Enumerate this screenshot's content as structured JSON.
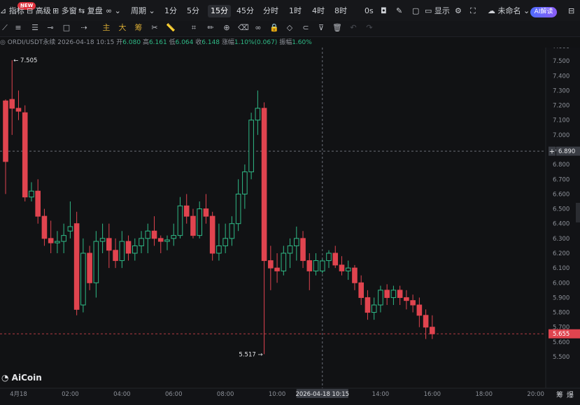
{
  "toolbar": {
    "new_badge": "NEW",
    "indicators": "指标",
    "advanced": "高级",
    "multi_window": "多窗",
    "replay": "复盘",
    "infinity": "∞",
    "period": "周期",
    "intervals": [
      "1分",
      "5分",
      "15分",
      "45分",
      "分时",
      "1时",
      "4时",
      "8时"
    ],
    "active_interval": "15分",
    "zero_s": "0s",
    "display": "显示",
    "unnamed": "未命名",
    "ai_explain": "AI解读"
  },
  "draw_tools": {
    "main": "主",
    "big": "大",
    "chips": "筹"
  },
  "info_bar": {
    "symbol": "ORDI/USDT永续",
    "datetime": "2026-04-18 10:15",
    "open_label": "开",
    "open": "6.080",
    "high_label": "高",
    "high": "6.161",
    "low_label": "低",
    "low": "6.064",
    "close_label": "收",
    "close": "6.148",
    "change_label": "涨幅",
    "change": "1.10%(0.067)",
    "amplitude_label": "振幅",
    "amplitude": "1.60%"
  },
  "watermark": "AiCoin",
  "price_axis": [
    "7.600",
    "7.500",
    "7.400",
    "7.300",
    "7.200",
    "7.100",
    "7.000",
    "6.900",
    "6.800",
    "6.700",
    "6.600",
    "6.500",
    "6.400",
    "6.300",
    "6.200",
    "6.100",
    "6.000",
    "5.900",
    "5.800",
    "5.700",
    "5.600",
    "5.500"
  ],
  "time_axis": [
    "4月18",
    "02:00",
    "04:00",
    "06:00",
    "08:00",
    "10:00",
    "12:00",
    "14:00",
    "16:00",
    "18:00",
    "20:00"
  ],
  "crosshair": {
    "price": "6.890",
    "time": "2026-04-18 10:15"
  },
  "last_price": "5.655",
  "high_marker": "← 7.505",
  "low_marker": "5.517 →",
  "bottom_right": [
    "筹",
    "爆"
  ],
  "colors": {
    "up": "#2fb986",
    "down": "#e0444f",
    "bg": "#111214",
    "crosshair": "#6b6f78"
  },
  "chart_data": {
    "type": "candlestick",
    "ylim": [
      5.45,
      7.65
    ],
    "x_ticks": [
      "4月18",
      "02:00",
      "04:00",
      "06:00",
      "08:00",
      "10:00",
      "12:00",
      "14:00",
      "16:00",
      "18:00",
      "20:00"
    ],
    "candles": [
      [
        7.23,
        7.24,
        6.6,
        6.82
      ],
      [
        7.24,
        7.505,
        7.0,
        7.18
      ],
      [
        7.18,
        7.3,
        7.1,
        7.16
      ],
      [
        7.15,
        7.2,
        6.55,
        6.58
      ],
      [
        6.58,
        6.68,
        6.55,
        6.62
      ],
      [
        6.62,
        6.7,
        6.4,
        6.45
      ],
      [
        6.45,
        6.5,
        6.25,
        6.3
      ],
      [
        6.3,
        6.42,
        6.2,
        6.27
      ],
      [
        6.27,
        6.35,
        6.2,
        6.28
      ],
      [
        6.28,
        6.4,
        6.2,
        6.32
      ],
      [
        6.35,
        6.55,
        6.3,
        6.38
      ],
      [
        6.4,
        6.48,
        5.78,
        5.82
      ],
      [
        5.85,
        6.3,
        5.8,
        6.2
      ],
      [
        6.2,
        6.25,
        5.95,
        6.0
      ],
      [
        6.0,
        6.35,
        5.9,
        6.28
      ],
      [
        6.28,
        6.4,
        6.2,
        6.3
      ],
      [
        6.3,
        6.4,
        6.1,
        6.22
      ],
      [
        6.22,
        6.3,
        6.1,
        6.15
      ],
      [
        6.15,
        6.35,
        6.1,
        6.28
      ],
      [
        6.28,
        6.32,
        6.15,
        6.2
      ],
      [
        6.2,
        6.3,
        6.15,
        6.25
      ],
      [
        6.25,
        6.35,
        6.2,
        6.3
      ],
      [
        6.3,
        6.4,
        6.2,
        6.35
      ],
      [
        6.35,
        6.45,
        6.25,
        6.3
      ],
      [
        6.3,
        6.32,
        6.2,
        6.28
      ],
      [
        6.28,
        6.32,
        6.22,
        6.29
      ],
      [
        6.3,
        6.4,
        6.25,
        6.32
      ],
      [
        6.32,
        6.58,
        6.3,
        6.52
      ],
      [
        6.52,
        6.6,
        6.4,
        6.45
      ],
      [
        6.45,
        6.5,
        6.3,
        6.32
      ],
      [
        6.32,
        6.55,
        6.3,
        6.5
      ],
      [
        6.5,
        6.6,
        6.4,
        6.45
      ],
      [
        6.45,
        6.48,
        6.15,
        6.2
      ],
      [
        6.2,
        6.4,
        6.15,
        6.25
      ],
      [
        6.25,
        6.4,
        6.2,
        6.3
      ],
      [
        6.3,
        6.45,
        6.25,
        6.4
      ],
      [
        6.4,
        6.7,
        6.35,
        6.6
      ],
      [
        6.6,
        6.8,
        6.5,
        6.75
      ],
      [
        6.75,
        7.15,
        6.7,
        7.1
      ],
      [
        7.1,
        7.3,
        7.0,
        7.18
      ],
      [
        7.18,
        7.22,
        5.517,
        6.15
      ],
      [
        6.15,
        6.25,
        5.95,
        6.1
      ],
      [
        6.1,
        6.2,
        6.0,
        6.08
      ],
      [
        6.08,
        6.25,
        6.05,
        6.2
      ],
      [
        6.2,
        6.3,
        6.1,
        6.25
      ],
      [
        6.25,
        6.38,
        6.15,
        6.3
      ],
      [
        6.3,
        6.35,
        6.1,
        6.15
      ],
      [
        6.15,
        6.2,
        5.95,
        6.08
      ],
      [
        6.08,
        6.2,
        6.05,
        6.15
      ],
      [
        6.08,
        6.161,
        6.064,
        6.148
      ],
      [
        6.15,
        6.22,
        6.1,
        6.2
      ],
      [
        6.2,
        6.25,
        6.1,
        6.12
      ],
      [
        6.12,
        6.18,
        6.05,
        6.08
      ],
      [
        6.08,
        6.15,
        6.02,
        6.1
      ],
      [
        6.1,
        6.12,
        5.95,
        6.0
      ],
      [
        6.0,
        6.05,
        5.85,
        5.9
      ],
      [
        5.9,
        5.95,
        5.75,
        5.8
      ],
      [
        5.8,
        5.9,
        5.75,
        5.85
      ],
      [
        5.85,
        5.98,
        5.8,
        5.95
      ],
      [
        5.95,
        5.99,
        5.85,
        5.9
      ],
      [
        5.9,
        5.98,
        5.85,
        5.95
      ],
      [
        5.95,
        5.98,
        5.85,
        5.9
      ],
      [
        5.9,
        5.95,
        5.82,
        5.88
      ],
      [
        5.88,
        5.92,
        5.8,
        5.85
      ],
      [
        5.85,
        5.9,
        5.7,
        5.78
      ],
      [
        5.78,
        5.82,
        5.62,
        5.7
      ],
      [
        5.7,
        5.78,
        5.62,
        5.655
      ]
    ]
  }
}
